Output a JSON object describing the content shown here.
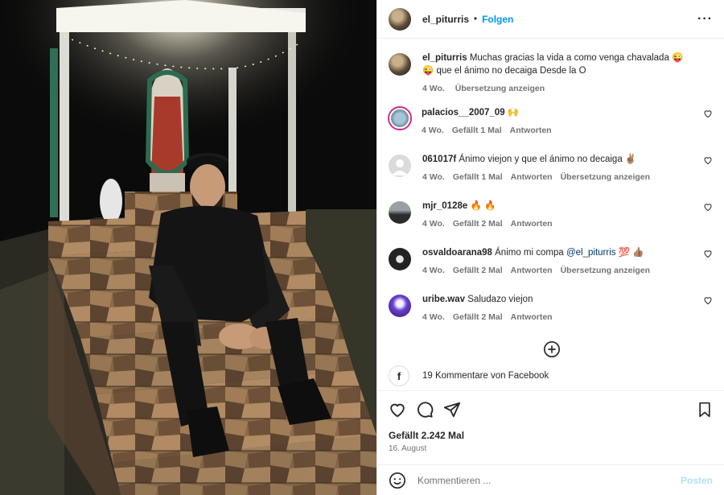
{
  "post": {
    "username": "el_piturris",
    "follow_label": "Folgen",
    "more_icon": "more-horizontal-icon"
  },
  "caption": {
    "username": "el_piturris",
    "text": "Muchas gracias la vida a como venga chavalada 😜",
    "text2": "😜 que el ánimo no decaiga Desde la O",
    "time": "4 Wo.",
    "translate": "Übersetzung anzeigen"
  },
  "comments": [
    {
      "username": "palacios__2007_09",
      "text": "🙌",
      "time": "4 Wo.",
      "likes": "Gefällt 1 Mal",
      "reply": "Antworten"
    },
    {
      "username": "061017f",
      "text": "Ánimo viejon y que el ánimo no decaiga ✌🏽",
      "time": "4 Wo.",
      "likes": "Gefällt 1 Mal",
      "reply": "Antworten",
      "translate": "Übersetzung anzeigen"
    },
    {
      "username": "mjr_0128e",
      "text": "🔥 🔥",
      "time": "4 Wo.",
      "likes": "Gefällt 2 Mal",
      "reply": "Antworten"
    },
    {
      "username": "osvaldoarana98",
      "text": "Ánimo mi compa",
      "mention": "@el_piturris",
      "text_after": "💯 👍🏽",
      "time": "4 Wo.",
      "likes": "Gefällt 2 Mal",
      "reply": "Antworten",
      "translate": "Übersetzung anzeigen"
    },
    {
      "username": "uribe.wav",
      "text": "Saludazo viejon",
      "time": "4 Wo.",
      "likes": "Gefällt 2 Mal",
      "reply": "Antworten"
    }
  ],
  "facebook": {
    "text": "19 Kommentare von Facebook",
    "icon_letter": "f"
  },
  "stats": {
    "likes": "Gefällt 2.242 Mal",
    "date": "16. August"
  },
  "composer": {
    "placeholder": "Kommentieren ...",
    "post_label": "Posten"
  },
  "colors": {
    "link": "#0095f6",
    "muted": "#737373",
    "post_disabled": "#b2dffc"
  }
}
